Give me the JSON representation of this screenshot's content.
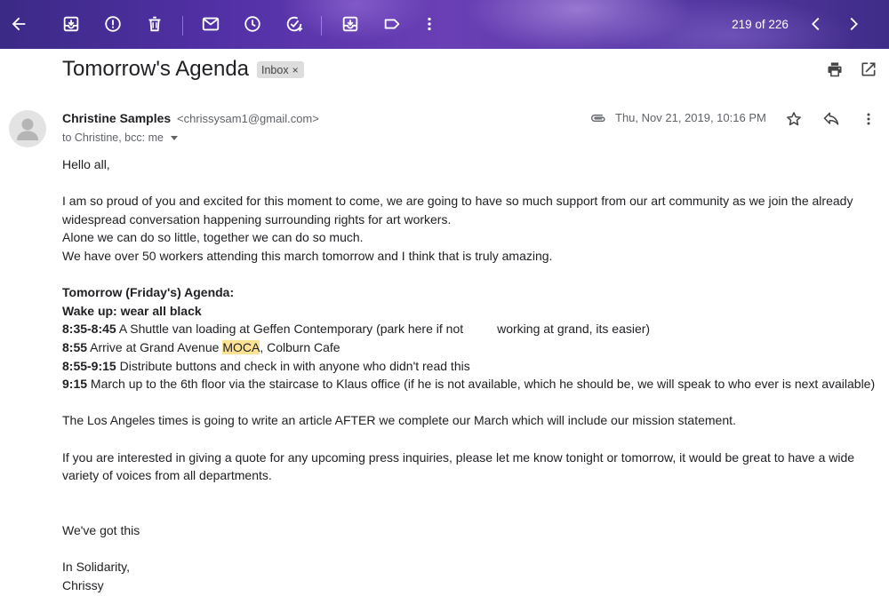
{
  "toolbar": {
    "counter": "219 of 226",
    "icons": [
      "back-arrow-icon",
      "archive-icon",
      "report-spam-icon",
      "delete-icon",
      "mark-unread-icon",
      "snooze-icon",
      "add-to-tasks-icon",
      "move-to-icon",
      "labels-icon",
      "more-vert-icon",
      "prev-chevron-icon",
      "next-chevron-icon"
    ]
  },
  "subject": {
    "title": "Tomorrow's Agenda",
    "label": "Inbox",
    "label_remove": "×"
  },
  "message": {
    "sender_name": "Christine Samples",
    "sender_email": "<chrissysam1@gmail.com>",
    "recipients": "to Christine, bcc: me",
    "date": "Thu, Nov 21, 2019, 10:16 PM"
  },
  "body": {
    "greeting": "Hello all,",
    "para1_line1": "I am so proud of you and excited for this moment to come, we are going to have so much support from our art community as we join the already",
    "para1_line2": "widespread conversation happening surrounding rights for art workers.",
    "para1_line3": "Alone we can do so little, together we can do so much.",
    "para1_line4": "We have over 50 workers attending this march tomorrow and I think that is truly amazing.",
    "agenda_title": "Tomorrow (Friday's) Agenda:",
    "wake_up": "Wake up: wear all black",
    "item1_time": "8:35-8:45",
    "item1_text_a": " A Shuttle van loading at Geffen Contemporary (park here if not",
    "item1_text_b": "working at grand, its easier)",
    "item2_time": "8:55",
    "item2_text_a": " Arrive at Grand Avenue ",
    "item2_highlight": "MOCA",
    "item2_text_b": ", Colburn Cafe",
    "item3_time": "8:55-9:15",
    "item3_text": " Distribute buttons and check in with anyone who didn't read this",
    "item4_time": "9:15",
    "item4_text": " March up to the 6th floor via the staircase to Klaus office (if he is not available, which he should be, we will speak to who ever is next available)",
    "times_para": "The Los Angeles times is going to write an article AFTER we complete our March which will include our mission statement.",
    "quote_line1": "If you are interested in giving a quote for any upcoming press inquiries, please let me know tonight or tomorrow, it would be great to have a wide",
    "quote_line2": "variety of voices from all departments.",
    "closing1": "We've got this",
    "closing2": "In Solidarity,",
    "signature": "Chrissy"
  },
  "colors": {
    "toolbar_gradient": [
      "#3b2a86",
      "#6a3fb5",
      "#3f2c88"
    ],
    "highlight": "#fde293",
    "label_chip": "#dddddd"
  }
}
